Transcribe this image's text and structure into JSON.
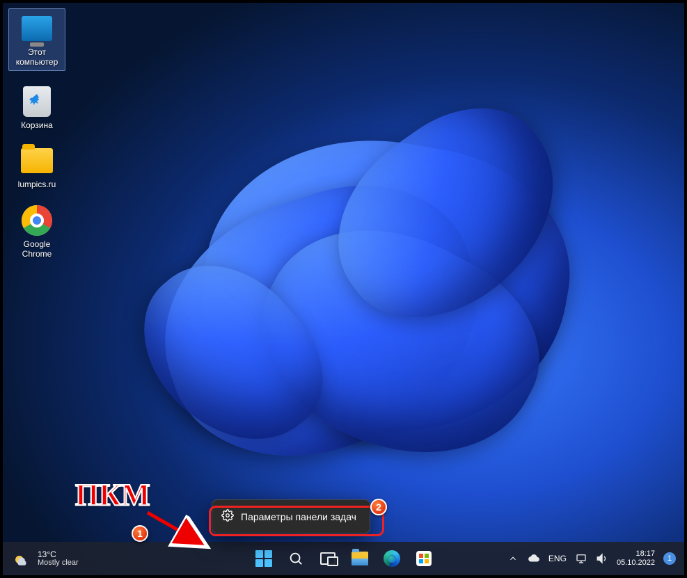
{
  "desktop": {
    "icons": [
      {
        "label": "Этот компьютер",
        "name": "this-pc",
        "selected": true
      },
      {
        "label": "Корзина",
        "name": "recycle-bin",
        "selected": false
      },
      {
        "label": "lumpics.ru",
        "name": "folder-lumpics",
        "selected": false
      },
      {
        "label": "Google Chrome",
        "name": "google-chrome",
        "selected": false
      }
    ]
  },
  "context_menu": {
    "items": [
      {
        "label": "Параметры панели задач",
        "icon": "gear-icon"
      }
    ]
  },
  "annotation": {
    "text": "ПКМ",
    "badge1": "1",
    "badge2": "2"
  },
  "taskbar": {
    "weather": {
      "temp": "13°C",
      "condition": "Mostly clear"
    },
    "pinned": [
      {
        "name": "start"
      },
      {
        "name": "search"
      },
      {
        "name": "task-view"
      },
      {
        "name": "file-explorer"
      },
      {
        "name": "edge"
      },
      {
        "name": "microsoft-store"
      }
    ],
    "tray": {
      "chevron": "ˆ",
      "onedrive": "cloud",
      "language": "ENG",
      "network": "net",
      "volume": "vol"
    },
    "clock": {
      "time": "18:17",
      "date": "05.10.2022"
    },
    "notifications": "1"
  }
}
